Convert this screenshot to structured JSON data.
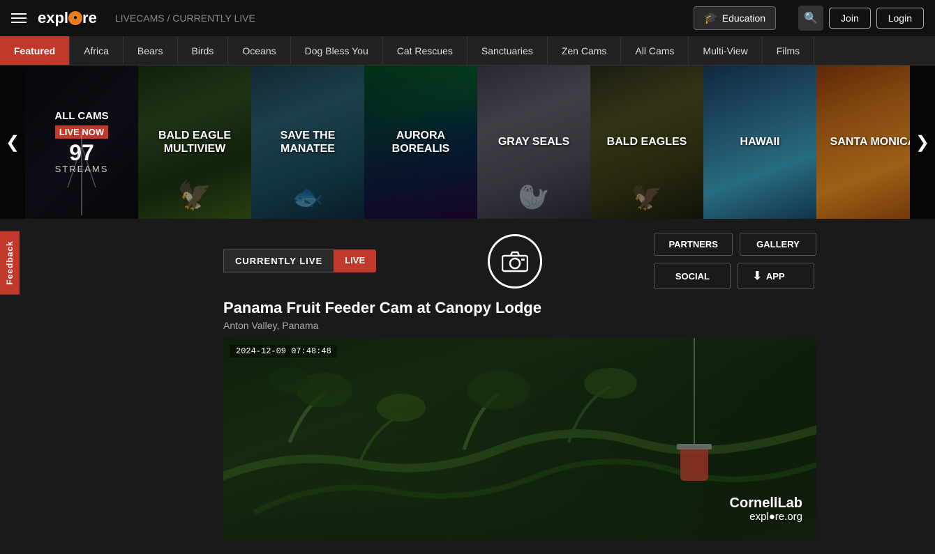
{
  "header": {
    "logo_text": "expl",
    "logo_o": "o",
    "logo_re": "re",
    "livecams_label": "LIVECAMS / CURRENTLY LIVE",
    "education_label": "Education",
    "search_icon": "🔍",
    "join_label": "Join",
    "login_label": "Login"
  },
  "nav": {
    "items": [
      {
        "label": "Featured",
        "active": true
      },
      {
        "label": "Africa"
      },
      {
        "label": "Bears"
      },
      {
        "label": "Birds"
      },
      {
        "label": "Oceans"
      },
      {
        "label": "Dog Bless You"
      },
      {
        "label": "Cat Rescues"
      },
      {
        "label": "Sanctuaries"
      },
      {
        "label": "Zen Cams"
      },
      {
        "label": "All Cams"
      },
      {
        "label": "Multi-View"
      },
      {
        "label": "Films"
      }
    ]
  },
  "carousel": {
    "left_arrow": "❮",
    "right_arrow": "❯",
    "items": [
      {
        "id": "allcams",
        "title": "ALL CAMS",
        "subtitle": "LIVE NOW",
        "count": "97",
        "streams": "STREAMS",
        "bg": "allcams"
      },
      {
        "id": "bald-eagle-multiview",
        "title": "BALD EAGLE MULTIVIEW",
        "bg": "eagle"
      },
      {
        "id": "save-the-manatee",
        "title": "SAVE THE MANATEE",
        "bg": "manatee"
      },
      {
        "id": "aurora-borealis",
        "title": "AURORA BOREALIS",
        "bg": "aurora"
      },
      {
        "id": "gray-seals",
        "title": "GRAY SEALS",
        "bg": "seals"
      },
      {
        "id": "bald-eagles",
        "title": "BALD EAGLES",
        "bg": "bald-eagles"
      },
      {
        "id": "hawaii",
        "title": "HAWAII",
        "bg": "hawaii"
      },
      {
        "id": "santa-monica",
        "title": "SANTA MONICA",
        "bg": "santa-monica"
      }
    ]
  },
  "live_section": {
    "currently_live_label": "CURRENTLY LIVE",
    "live_badge": "LIVE",
    "cam_title": "Panama Fruit Feeder Cam at Canopy Lodge",
    "cam_location": "Anton Valley, Panama",
    "timestamp": "2024-12-09 07:48:48",
    "partners_label": "PARTNERS",
    "gallery_label": "GALLERY",
    "social_label": "SOCIAL",
    "app_label": "APP",
    "watermark_top": "CornellLab",
    "watermark_bottom": "expl◎re.org"
  },
  "feedback": {
    "label": "Feedback"
  }
}
